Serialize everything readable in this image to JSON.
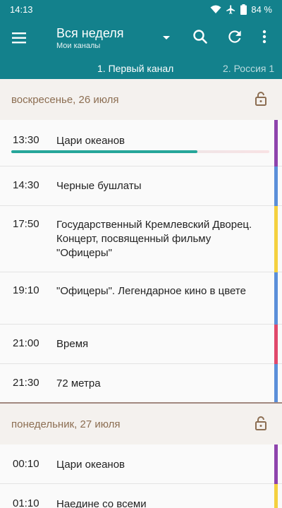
{
  "status_bar": {
    "time": "14:13",
    "battery": "84 %"
  },
  "app_bar": {
    "title": "Вся неделя",
    "subtitle": "Мои каналы"
  },
  "tabs": [
    {
      "label": "1. Первый канал",
      "active": true
    },
    {
      "label": "2. Россия 1",
      "active": false
    }
  ],
  "days": [
    {
      "label": "воскресенье, 26 июля",
      "programs": [
        {
          "time": "13:30",
          "title": "Цари океанов",
          "color": "#8e44ad",
          "progress": 0.72
        },
        {
          "time": "14:30",
          "title": "Черные бушлаты",
          "color": "#5b8fd9"
        },
        {
          "time": "17:50",
          "title": "Государственный Кремлевский Дворец. Концерт, посвященный фильму \"Офицеры\"",
          "color": "#f4d03f"
        },
        {
          "time": "19:10",
          "title": "\"Офицеры\". Легендарное кино в цвете",
          "color": "#5b8fd9"
        },
        {
          "time": "21:00",
          "title": "Время",
          "color": "#e0496b"
        },
        {
          "time": "21:30",
          "title": "72 метра",
          "color": "#5b8fd9"
        }
      ]
    },
    {
      "label": "понедельник, 27 июля",
      "programs": [
        {
          "time": "00:10",
          "title": "Цари океанов",
          "color": "#8e44ad"
        },
        {
          "time": "01:10",
          "title": "Наедине со всеми",
          "color": "#f4d03f"
        }
      ]
    }
  ],
  "colors": {
    "primary": "#13818c",
    "accent": "#26a69a",
    "day_header_text": "#8c6e52"
  },
  "icons": [
    "menu-icon",
    "dropdown-arrow-icon",
    "search-icon",
    "refresh-icon",
    "more-vert-icon",
    "lock-icon",
    "wifi-icon",
    "airplane-icon",
    "battery-icon"
  ]
}
